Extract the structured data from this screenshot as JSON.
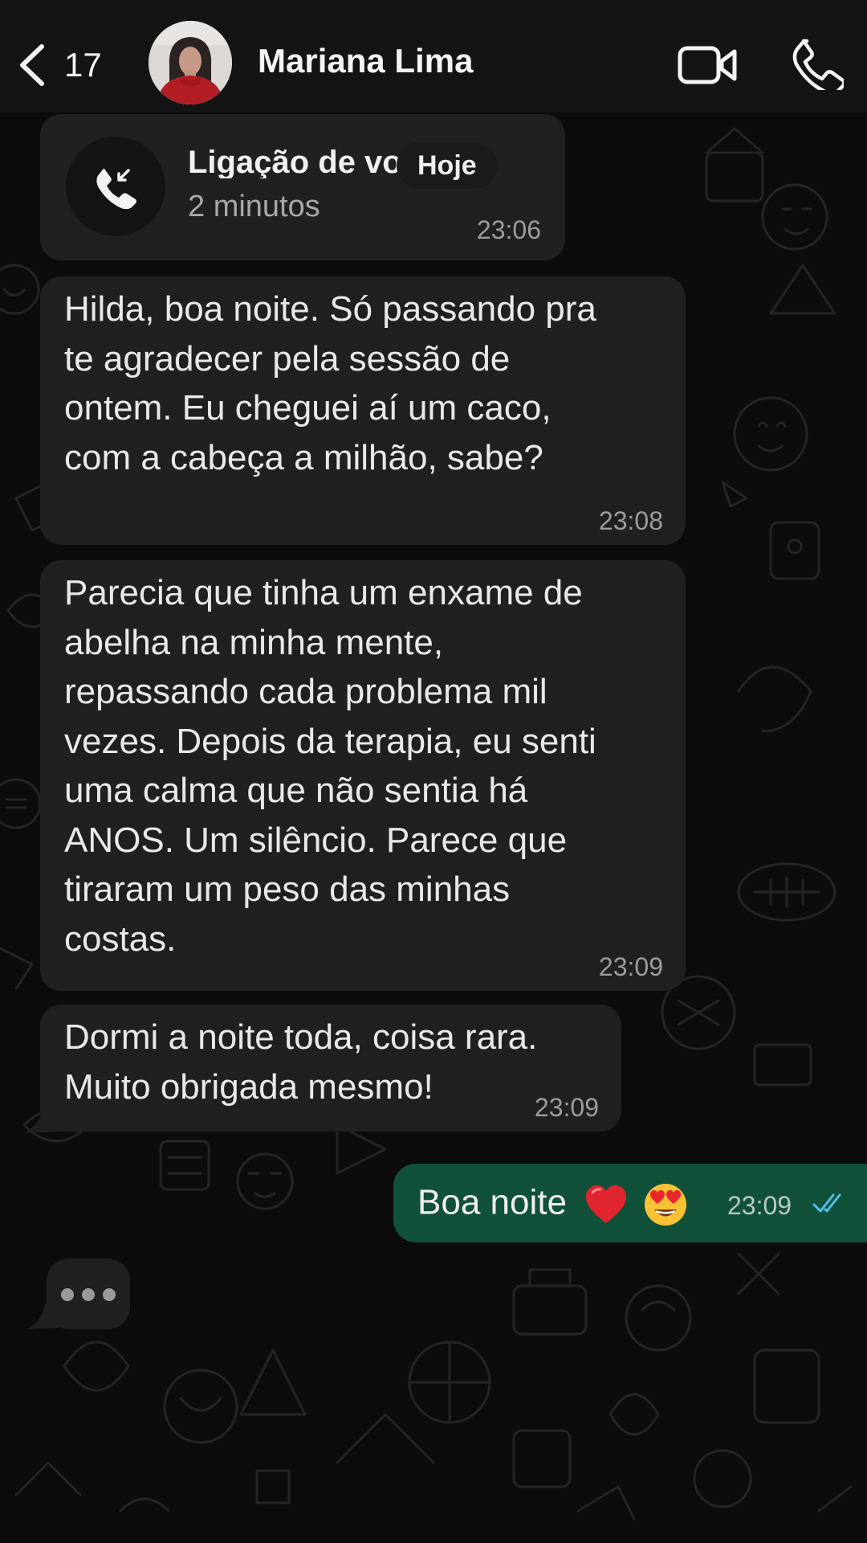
{
  "header": {
    "back_count": "17",
    "contact_name": "Mariana Lima"
  },
  "call": {
    "title": "Ligação de voz",
    "duration": "2 minutos",
    "time": "23:06"
  },
  "date_label": "Hoje",
  "messages": [
    {
      "direction": "incoming",
      "lines": [
        "Hilda, boa noite. Só passando pra",
        "te agradecer pela sessão de",
        "ontem. Eu cheguei aí um caco,",
        "com a cabeça a milhão, sabe?"
      ],
      "time": "23:08"
    },
    {
      "direction": "incoming",
      "lines": [
        "Parecia que tinha um enxame de",
        "abelha na minha mente,",
        "repassando cada problema mil",
        "vezes. Depois da terapia, eu senti",
        "uma calma que não sentia há",
        "ANOS. Um silêncio. Parece que",
        "tiraram um peso das minhas",
        "costas."
      ],
      "time": "23:09"
    },
    {
      "direction": "incoming",
      "lines": [
        "Dormi a noite toda, coisa rara.",
        "Muito obrigada mesmo!"
      ],
      "time": "23:09"
    },
    {
      "direction": "outgoing",
      "text": "Boa noite",
      "emoji": [
        "red-heart",
        "heart-eyes-face"
      ],
      "time": "23:09",
      "status": "read"
    }
  ],
  "typing_indicator": "•••",
  "colors": {
    "background": "#0c0c0c",
    "incoming_bubble": "#202020",
    "outgoing_bubble": "#125139",
    "read_ticks": "#53bdeb"
  }
}
